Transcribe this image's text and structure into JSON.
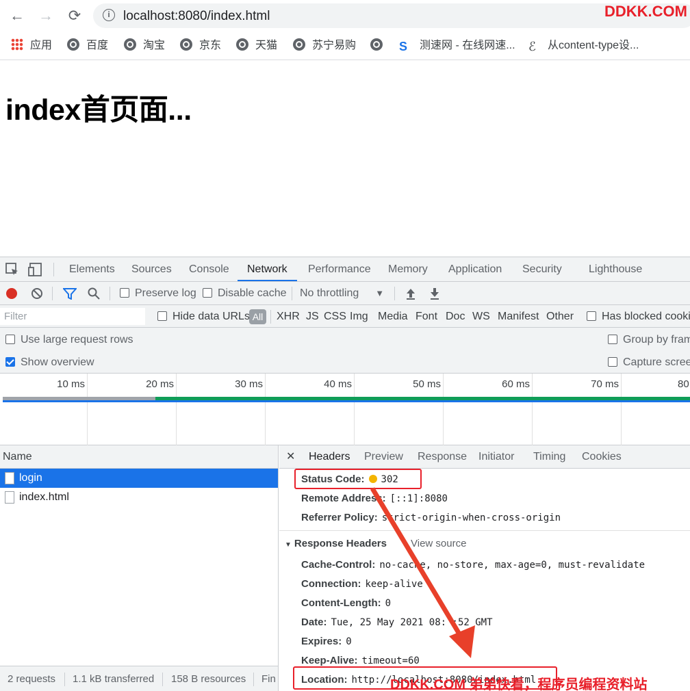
{
  "browser": {
    "url": "localhost:8080/index.html",
    "watermark": "DDKK.COM",
    "bookmarks": [
      "应用",
      "百度",
      "淘宝",
      "京东",
      "天猫",
      "苏宁易购",
      "测速网 - 在线网速...",
      "从content-type设..."
    ]
  },
  "page": {
    "heading": "index首页面..."
  },
  "devtools": {
    "tabs": [
      "Elements",
      "Sources",
      "Console",
      "Network",
      "Performance",
      "Memory",
      "Application",
      "Security",
      "Lighthouse"
    ],
    "active_tab": "Network",
    "toolbar": {
      "preserve_log": "Preserve log",
      "disable_cache": "Disable cache",
      "throttling": "No throttling"
    },
    "filter": {
      "placeholder": "Filter",
      "hide_data_urls": "Hide data URLs",
      "all": "All",
      "types": [
        "XHR",
        "JS",
        "CSS",
        "Img",
        "Media",
        "Font",
        "Doc",
        "WS",
        "Manifest",
        "Other"
      ],
      "has_blocked": "Has blocked cookie"
    },
    "options": {
      "large_rows": "Use large request rows",
      "show_overview": "Show overview",
      "group_by_frame": "Group by fram",
      "capture_screens": "Capture screen"
    },
    "timeline_ticks": [
      "10 ms",
      "20 ms",
      "30 ms",
      "40 ms",
      "50 ms",
      "60 ms",
      "70 ms",
      "80"
    ],
    "requests": {
      "header": "Name",
      "items": [
        "login",
        "index.html"
      ]
    },
    "details": {
      "tabs": [
        "Headers",
        "Preview",
        "Response",
        "Initiator",
        "Timing",
        "Cookies"
      ],
      "general": [
        {
          "k": "Status Code:",
          "v": "302"
        },
        {
          "k": "Remote Address:",
          "v": "[::1]:8080"
        },
        {
          "k": "Referrer Policy:",
          "v": "strict-origin-when-cross-origin"
        }
      ],
      "response_headers_title": "Response Headers",
      "view_source": "View source",
      "response_headers": [
        {
          "k": "Cache-Control:",
          "v": "no-cache, no-store, max-age=0, must-revalidate"
        },
        {
          "k": "Connection:",
          "v": "keep-alive"
        },
        {
          "k": "Content-Length:",
          "v": "0"
        },
        {
          "k": "Date:",
          "v": "Tue, 25 May 2021 08:  :52 GMT"
        },
        {
          "k": "Expires:",
          "v": "0"
        },
        {
          "k": "Keep-Alive:",
          "v": "timeout=60"
        },
        {
          "k": "Location:",
          "v": "http://localhost:8080/index.html"
        }
      ]
    },
    "statusbar": [
      "2 requests",
      "1.1 kB transferred",
      "158 B resources",
      "Fin"
    ]
  },
  "watermark_bottom": "DDKK.COM 弟弟快看，程序员编程资料站",
  "colors": {
    "accent": "#1a73e8",
    "annotation": "#e8202a",
    "status_dot": "#f4b400"
  }
}
